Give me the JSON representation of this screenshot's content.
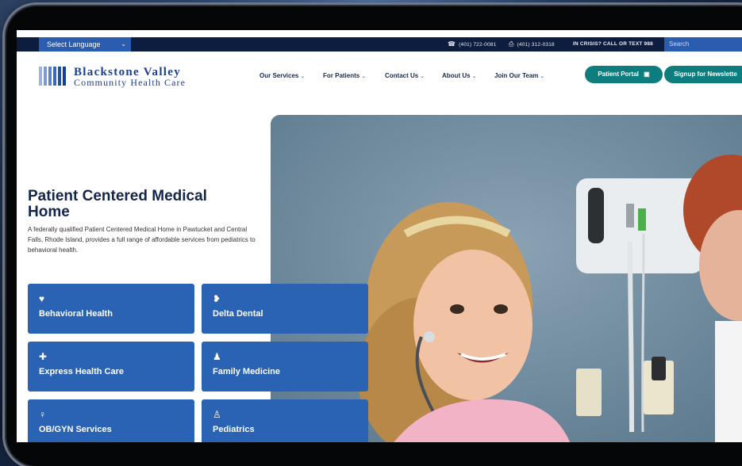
{
  "topbar": {
    "language_label": "Select Language",
    "phone1": "(401) 722-0081",
    "phone2": "(401) 312-0318",
    "crisis_text": "IN CRISIS? CALL OR TEXT 988",
    "search_placeholder": "Search"
  },
  "logo": {
    "line1": "Blackstone Valley",
    "line2": "Community Health Care"
  },
  "nav": {
    "items": [
      {
        "label": "Our Services"
      },
      {
        "label": "For Patients"
      },
      {
        "label": "Contact Us"
      },
      {
        "label": "About Us"
      },
      {
        "label": "Join Our Team"
      }
    ],
    "patient_portal": "Patient Portal",
    "newsletter": "Signup for Newslette"
  },
  "hero": {
    "title": "Patient Centered Medical Home",
    "description": "A federally qualified Patient Centered Medical Home in Pawtucket and Central Falls, Rhode Island, provides a full range of affordable services from pediatrics to behavioral health."
  },
  "services": [
    {
      "label": "Behavioral Health",
      "icon": "heart-icon"
    },
    {
      "label": "Delta Dental",
      "icon": "tooth-icon"
    },
    {
      "label": "Express Health Care",
      "icon": "plus-icon"
    },
    {
      "label": "Family Medicine",
      "icon": "family-icon"
    },
    {
      "label": "OB/GYN Services",
      "icon": "female-icon"
    },
    {
      "label": "Pediatrics",
      "icon": "child-icon"
    }
  ],
  "colors": {
    "navy": "#0c1d3f",
    "brand_blue": "#2a62b4",
    "teal": "#0d7d7d"
  }
}
